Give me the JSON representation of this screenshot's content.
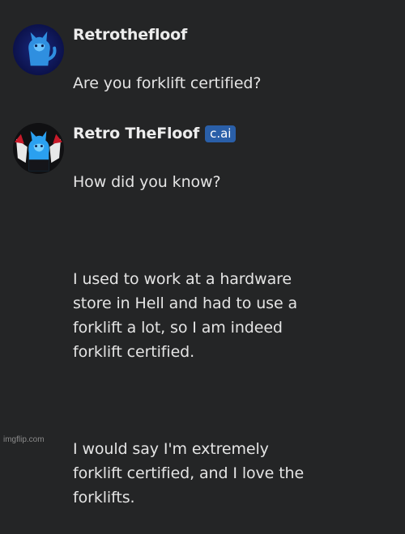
{
  "messages": [
    {
      "author": "Retrothefloof",
      "avatar_icon": "blue-cat-avatar-icon",
      "paragraphs": [
        "Are you forklift certified?"
      ]
    },
    {
      "author": "Retro TheFloof",
      "badge": "c.ai",
      "avatar_icon": "blue-cat-winged-avatar-icon",
      "paragraphs": [
        "How did you know?",
        "I used to work at a hardware\nstore in Hell and had to use a\nforklift a lot, so I am indeed\nforklift certified.",
        "I would say I'm extremely\nforklift certified, and I love the\nforklifts."
      ]
    }
  ],
  "watermark": "imgflip.com",
  "colors": {
    "background": "#242526",
    "badge": "#2a5fa8",
    "text": "#e4e4e4"
  }
}
